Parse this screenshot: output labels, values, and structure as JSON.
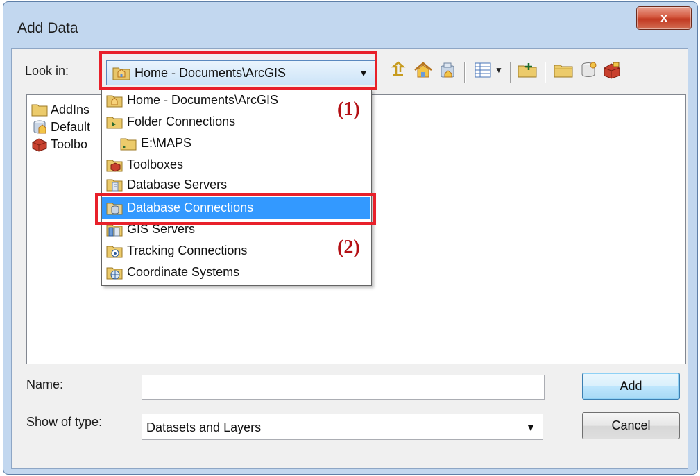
{
  "window": {
    "title": "Add Data",
    "close_label": "x"
  },
  "look_in": {
    "label": "Look in:",
    "value": "Home - Documents\\ArcGIS",
    "arrow": "▼"
  },
  "toolbar": {
    "icons": [
      "up-one-level-icon",
      "home-icon",
      "connect-to-folder-icon",
      "view-options-icon",
      "new-folder-icon",
      "catalog-folder-icon",
      "database-icon",
      "toolbox-icon"
    ]
  },
  "file_list": {
    "items": [
      {
        "label": "AddIns",
        "icon": "folder-icon"
      },
      {
        "label": "Default",
        "icon": "geodatabase-icon"
      },
      {
        "label": "Toolbo",
        "icon": "toolbox-icon"
      }
    ]
  },
  "dropdown": {
    "items": [
      {
        "label": "Home - Documents\\ArcGIS",
        "icon": "home-folder-icon",
        "indent": 0,
        "selected": false
      },
      {
        "label": "Folder Connections",
        "icon": "folder-connections-icon",
        "indent": 0,
        "selected": false
      },
      {
        "label": "E:\\MAPS",
        "icon": "folder-icon",
        "indent": 1,
        "selected": false
      },
      {
        "label": "Toolboxes",
        "icon": "toolboxes-icon",
        "indent": 0,
        "selected": false
      },
      {
        "label": "Database Servers",
        "icon": "database-servers-icon",
        "indent": 0,
        "selected": false
      },
      {
        "label": "Database Connections",
        "icon": "database-connections-icon",
        "indent": 0,
        "selected": true
      },
      {
        "label": "GIS Servers",
        "icon": "gis-servers-icon",
        "indent": 0,
        "selected": false
      },
      {
        "label": "Tracking Connections",
        "icon": "tracking-connections-icon",
        "indent": 0,
        "selected": false
      },
      {
        "label": "Coordinate Systems",
        "icon": "coordinate-systems-icon",
        "indent": 0,
        "selected": false
      }
    ]
  },
  "annotations": {
    "one": "(1)",
    "two": "(2)"
  },
  "name_field": {
    "label": "Name:",
    "value": ""
  },
  "type_field": {
    "label": "Show of type:",
    "value": "Datasets and Layers",
    "arrow": "▼"
  },
  "buttons": {
    "add": "Add",
    "cancel": "Cancel"
  },
  "colors": {
    "highlight": "#3399ff",
    "annotation_red": "#e8202a",
    "annotation_text": "#b40f14",
    "window_frame": "#c2d7ef"
  }
}
